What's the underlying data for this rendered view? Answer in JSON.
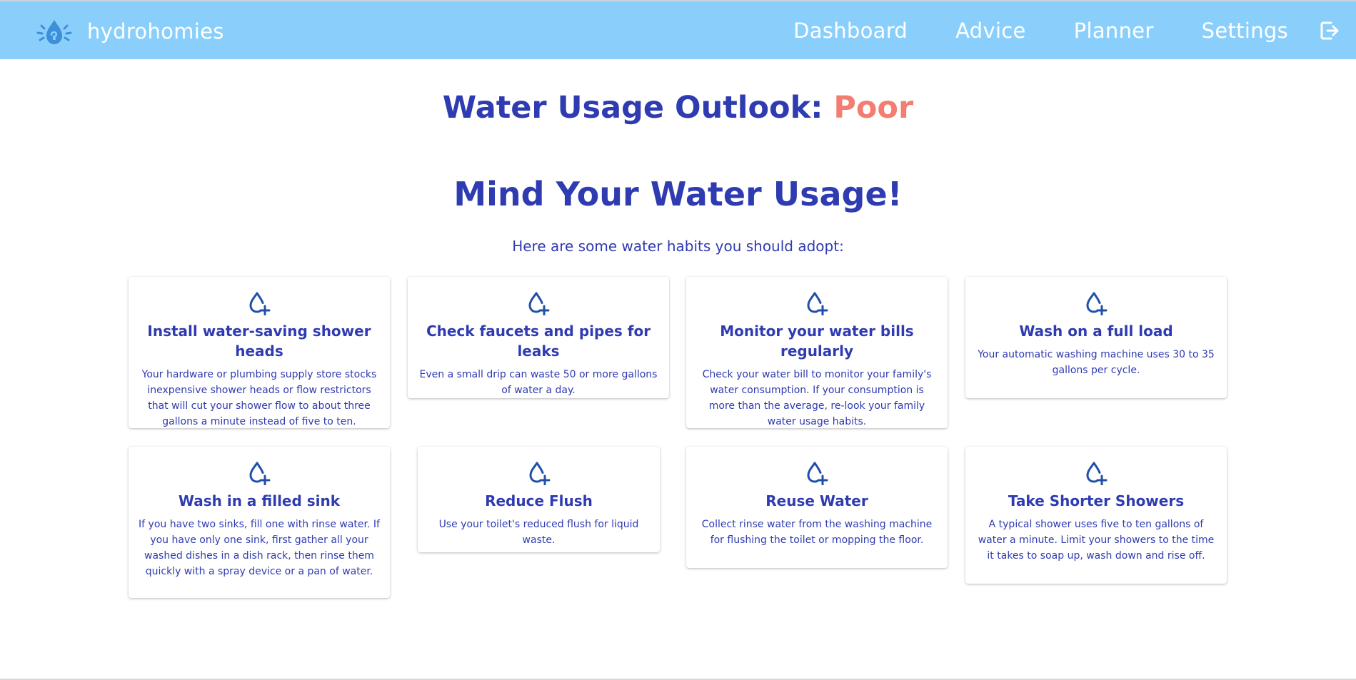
{
  "navbar": {
    "brand_name": "hydrohomies",
    "logo_icon": "water-drop-splash-icon",
    "links": [
      "Dashboard",
      "Advice",
      "Planner",
      "Settings"
    ],
    "logout_icon": "logout-icon",
    "background_color": "#8acffc"
  },
  "outlook": {
    "label": "Water Usage Outlook:",
    "rating": "Poor",
    "rating_color": "#f47d72"
  },
  "headline": "Mind Your Water Usage!",
  "subheadline": "Here are some water habits you should adopt:",
  "tips": [
    {
      "icon": "water-drop-plus-icon",
      "title": "Install water-saving shower heads",
      "body": "Your hardware or plumbing supply store stocks inexpensive shower heads or flow restrictors that will cut your shower flow to about three gallons a minute instead of five to ten."
    },
    {
      "icon": "water-drop-plus-icon",
      "title": "Check faucets and pipes for leaks",
      "body": "Even a small drip can waste 50 or more gallons of water a day."
    },
    {
      "icon": "water-drop-plus-icon",
      "title": "Monitor your water bills regularly",
      "body": "Check your water bill to monitor your family's water consumption. If your consumption is more than the average, re-look your family water usage habits."
    },
    {
      "icon": "water-drop-plus-icon",
      "title": "Wash on a full load",
      "body": "Your automatic washing machine uses 30 to 35 gallons per cycle."
    },
    {
      "icon": "water-drop-plus-icon",
      "title": "Wash in a filled sink",
      "body": "If you have two sinks, fill one with rinse water. If you have only one sink, first gather all your washed dishes in a dish rack, then rinse them quickly with a spray device or a pan of water."
    },
    {
      "icon": "water-drop-plus-icon",
      "title": "Reduce Flush",
      "body": "Use your toilet's reduced flush for liquid waste."
    },
    {
      "icon": "water-drop-plus-icon",
      "title": "Reuse Water",
      "body": "Collect rinse water from the washing machine for flushing the toilet or mopping the floor."
    },
    {
      "icon": "water-drop-plus-icon",
      "title": "Take Shorter Showers",
      "body": "A typical shower uses five to ten gallons of water a minute. Limit your showers to the time it takes to soap up, wash down and rise off."
    }
  ],
  "colors": {
    "heading": "#2f3bb0",
    "icon": "#1f4fa8"
  }
}
